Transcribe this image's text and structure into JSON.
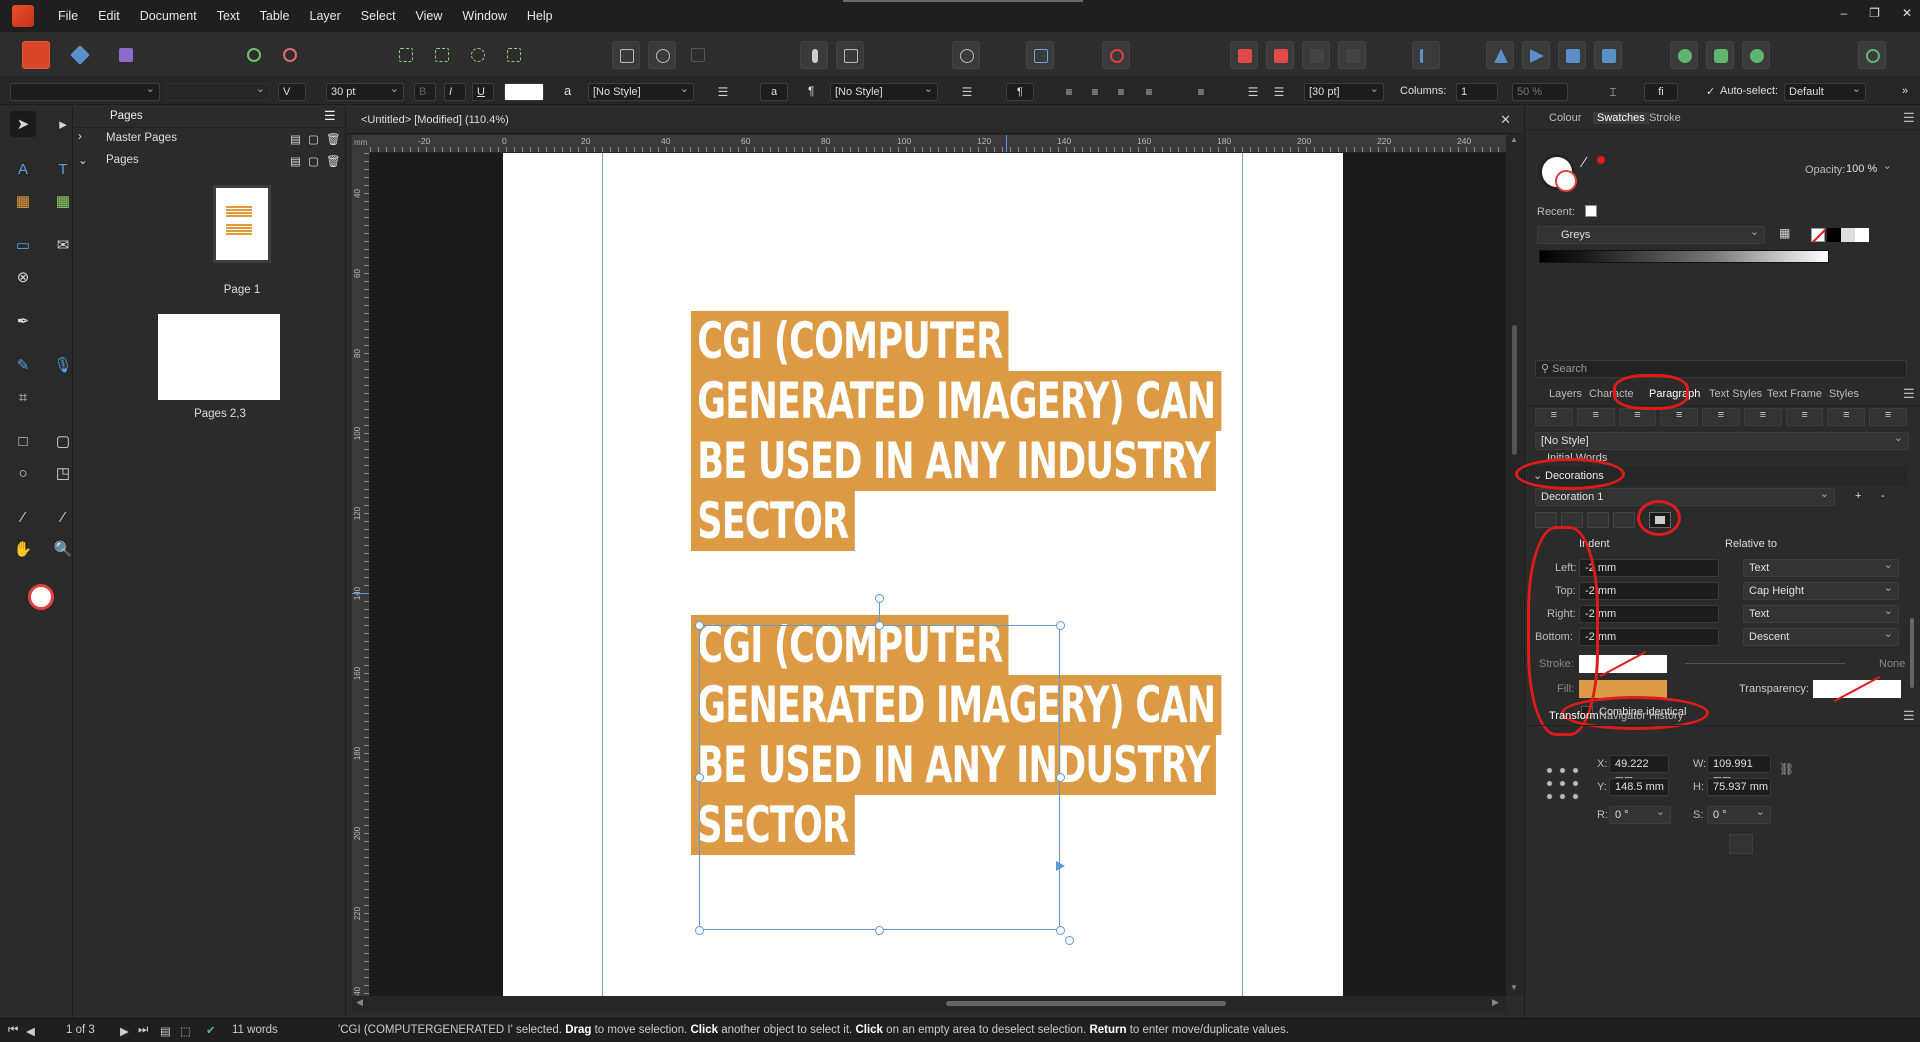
{
  "menu": [
    "File",
    "Edit",
    "Document",
    "Text",
    "Table",
    "Layer",
    "Select",
    "View",
    "Window",
    "Help"
  ],
  "window_buttons": [
    "–",
    "❐",
    "✕"
  ],
  "ctx": {
    "font_size": "30 pt",
    "char_style": "[No Style]",
    "para_style": "[No Style]",
    "leading": "[30 pt]",
    "columns_label": "Columns:",
    "columns_value": "1",
    "zoom_pct": "50 %",
    "autoselect_label": "Auto-select:",
    "autoselect_value": "Default",
    "italic": "I",
    "underline": "U",
    "bold": "B",
    "char_a": "a",
    "pilcrow": "¶",
    "fi": "fi"
  },
  "pages_panel": {
    "title": "Pages",
    "master_pages": "Master Pages",
    "pages": "Pages",
    "page1_label": "Page 1",
    "page23_label": "Pages 2,3"
  },
  "document": {
    "tab_title": "<Untitled> [Modified] (110.4%)",
    "close": "✕",
    "ruler_unit": "mm",
    "hruler": [
      "-20",
      "0",
      "20",
      "40",
      "60",
      "80",
      "100",
      "120",
      "140",
      "160",
      "180",
      "200",
      "220",
      "240"
    ],
    "vruler": [
      "40",
      "60",
      "80",
      "100",
      "120",
      "140",
      "160",
      "180",
      "200",
      "220",
      "240"
    ],
    "para1_lines": [
      "CGI (COMPUTER",
      "GENERATED IMAGERY) CAN",
      "BE USED IN ANY INDUSTRY",
      "SECTOR"
    ],
    "para2_lines": [
      "CGI (COMPUTER",
      "GENERATED IMAGERY) CAN",
      "BE USED IN ANY INDUSTRY",
      "SECTOR"
    ],
    "decoration_color": "#dd9a45"
  },
  "right_panel": {
    "top_tabs": [
      "Colour",
      "Swatches",
      "Stroke"
    ],
    "opacity_label": "Opacity:",
    "opacity_value": "100 %",
    "recent_label": "Recent:",
    "palette": "Greys",
    "search_placeholder": "Search",
    "studio_tabs": [
      "Layers",
      "Characte",
      "Paragraph",
      "Text Styles",
      "Text Frame",
      "Styles"
    ],
    "style_value": "[No Style]",
    "initial_words": "Initial Words",
    "decorations": "Decorations",
    "decoration_name": "Decoration 1",
    "add": "+",
    "remove": "-",
    "indent_label": "Indent",
    "relative_label": "Relative to",
    "rows": [
      {
        "label": "Left:",
        "value": "-2 mm",
        "relative": "Text"
      },
      {
        "label": "Top:",
        "value": "-2 mm",
        "relative": "Cap Height"
      },
      {
        "label": "Right:",
        "value": "-2 mm",
        "relative": "Text"
      },
      {
        "label": "Bottom:",
        "value": "-2 mm",
        "relative": "Descent"
      }
    ],
    "stroke_label": "Stroke:",
    "stroke_none": "None",
    "fill_label": "Fill:",
    "transparency_label": "Transparency:",
    "combine_label": "Combine identical",
    "bottom_tabs": [
      "Transform",
      "Navigator",
      "History"
    ],
    "transform": {
      "x_label": "X:",
      "x": "49.222 mm",
      "y_label": "Y:",
      "y": "148.5 mm",
      "w_label": "W:",
      "w": "109.991 mm",
      "h_label": "H:",
      "h": "75.937 mm",
      "r_label": "R:",
      "r": "0 °",
      "s_label": "S:",
      "s": "0 °"
    }
  },
  "status": {
    "page_of": "1 of 3",
    "words": "11 words",
    "sel_text": "'CGI (COMPUTERGENERATED I' selected.",
    "drag": "Drag",
    "drag_txt": "to move selection.",
    "click": "Click",
    "click_txt": "another object to select it.",
    "click2": "Click",
    "click2_txt": "on an empty area to deselect selection.",
    "ret": "Return",
    "ret_txt": "to enter move/duplicate values."
  }
}
